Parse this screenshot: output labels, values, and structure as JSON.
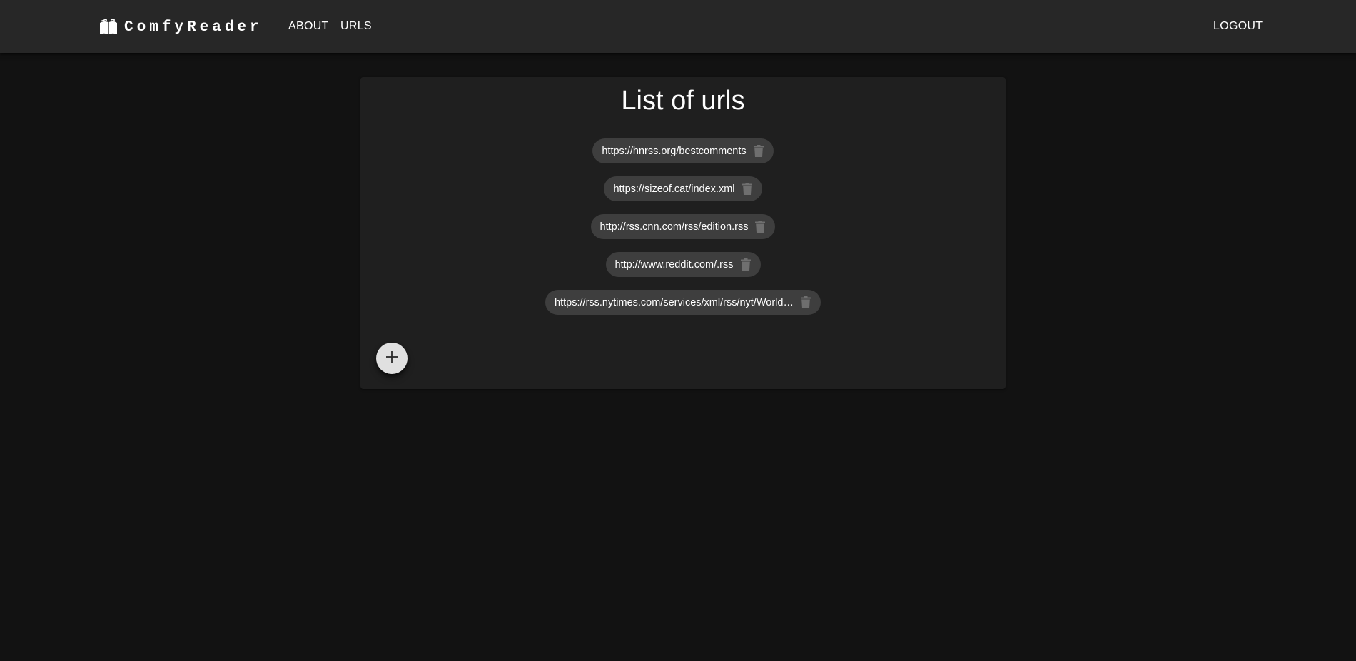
{
  "app": {
    "title": "ComfyReader",
    "logo_icon": "book-open-icon"
  },
  "nav": {
    "about_label": "ABOUT",
    "urls_label": "URLS",
    "logout_label": "LOGOUT"
  },
  "main": {
    "title": "List of urls",
    "urls": [
      {
        "label": "https://hnrss.org/bestcomments",
        "delete_icon": "trash-icon"
      },
      {
        "label": "https://sizeof.cat/index.xml",
        "delete_icon": "trash-icon"
      },
      {
        "label": "http://rss.cnn.com/rss/edition.rss",
        "delete_icon": "trash-icon"
      },
      {
        "label": "http://www.reddit.com/.rss",
        "delete_icon": "trash-icon"
      },
      {
        "label": "https://rss.nytimes.com/services/xml/rss/nyt/World…",
        "delete_icon": "trash-icon"
      }
    ],
    "add_button_icon": "plus-icon"
  },
  "colors": {
    "background": "#121212",
    "appbar": "#272727",
    "card": "#1f1f1f",
    "chip": "#3e3e3e",
    "chip_icon": "#6f6f6f",
    "fab": "#e0e0e0"
  }
}
